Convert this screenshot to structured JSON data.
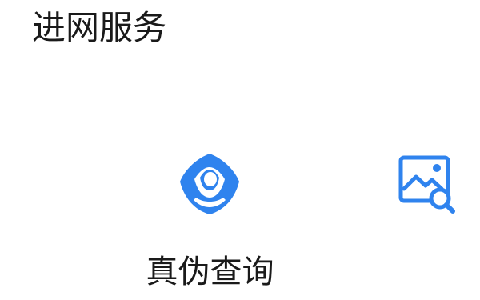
{
  "header": {
    "title": "进网服务"
  },
  "services": [
    {
      "label": "真伪查询",
      "icon": "eye-icon",
      "color": "#2f83ee"
    },
    {
      "label": "",
      "icon": "image-search-icon",
      "color": "#2f83ee"
    }
  ]
}
